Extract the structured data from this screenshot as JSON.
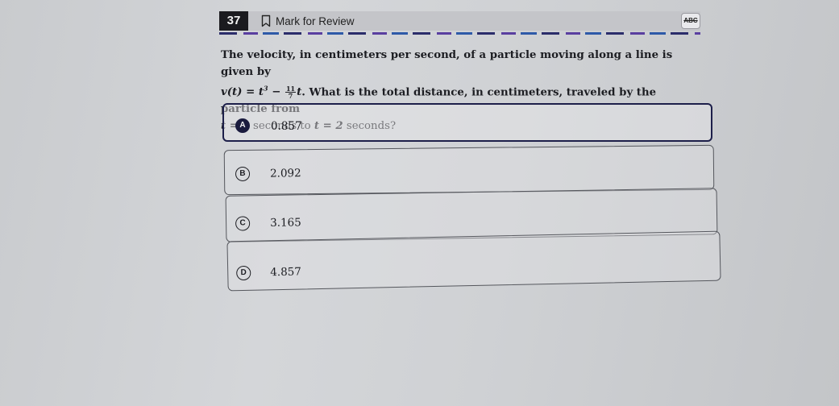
{
  "header": {
    "question_number": "37",
    "mark_for_review_label": "Mark for Review",
    "abc_button_label": "ABC"
  },
  "question": {
    "line1": "The velocity, in centimeters per second, of a particle moving along a line is given by",
    "v_of_t": "v(t) = t",
    "exponent": "3",
    "minus": " − ",
    "frac_num": "11",
    "frac_den": "7",
    "t_var": "t",
    "line2_rest": ". What is the total distance, in centimeters, traveled by the particle from",
    "t_eq_0": "t = 0",
    "seconds_to": " seconds to ",
    "t_eq_2": "t = 2",
    "seconds_end": " seconds?"
  },
  "choices": [
    {
      "letter": "A",
      "value": "0.857",
      "selected": true
    },
    {
      "letter": "B",
      "value": "2.092",
      "selected": false
    },
    {
      "letter": "C",
      "value": "3.165",
      "selected": false
    },
    {
      "letter": "D",
      "value": "4.857",
      "selected": false
    }
  ]
}
